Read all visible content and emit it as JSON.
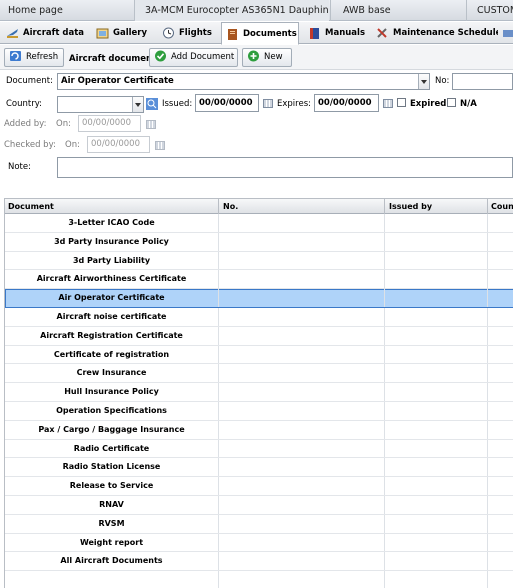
{
  "top_tabs": [
    "Home page",
    "3A-MCM Eurocopter AS365N1 Dauphin",
    "AWB base",
    "CUSTOM"
  ],
  "tabs": [
    {
      "label": "Aircraft data",
      "icon": "aircraft-data-icon"
    },
    {
      "label": "Gallery",
      "icon": "gallery-icon"
    },
    {
      "label": "Flights",
      "icon": "flights-icon"
    },
    {
      "label": "Documents",
      "icon": "documents-icon"
    },
    {
      "label": "Manuals",
      "icon": "manuals-icon"
    },
    {
      "label": "Maintenance Schedule",
      "icon": "maintenance-icon"
    }
  ],
  "toolbar": {
    "refresh": "Refresh",
    "aircraft_document": "Aircraft document:",
    "add_document": "Add Document",
    "new": "New"
  },
  "form": {
    "document_label": "Document:",
    "document_value": "Air Operator Certificate",
    "no_label": "No:",
    "country_label": "Country:",
    "issued_label": "Issued:",
    "issued_value": "00/00/0000",
    "expires_label": "Expires:",
    "expires_value": "00/00/0000",
    "expired_label": "Expired",
    "na_label": "N/A",
    "added_by_label": "Added by:",
    "added_on_label": "On:",
    "added_on_value": "00/00/0000",
    "checked_by_label": "Checked by:",
    "checked_on_label": "On:",
    "checked_on_value": "00/00/0000",
    "note_label": "Note:"
  },
  "table": {
    "columns": [
      "Document",
      "No.",
      "Issued by",
      "Count"
    ],
    "rows": [
      "3-Letter ICAO Code",
      "3d Party Insurance Policy",
      "3d Party Liability",
      "Aircraft Airworthiness Certificate",
      "Air Operator Certificate",
      "Aircraft noise certificate",
      "Aircraft Registration Certificate",
      "Certificate of registration",
      "Crew Insurance",
      "Hull Insurance Policy",
      "Operation Specifications",
      "Pax / Cargo / Baggage Insurance",
      "Radio Certificate",
      "Radio Station License",
      "Release to Service",
      "RNAV",
      "RVSM",
      "Weight report",
      "All Aircraft Documents",
      ""
    ],
    "selected_index": 4
  },
  "colors": {
    "selection": "#afd3f9",
    "selection_border": "#3a78c8"
  }
}
